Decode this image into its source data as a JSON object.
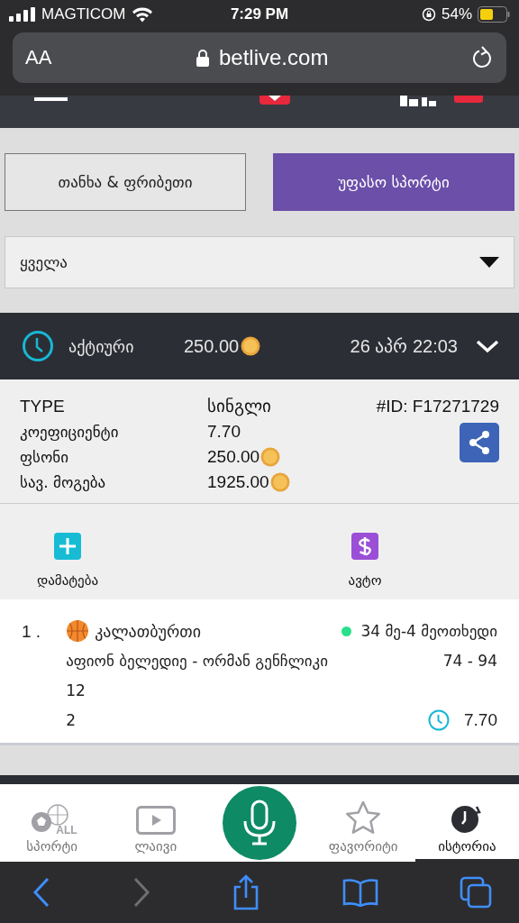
{
  "status_bar": {
    "carrier": "MAGTICOM",
    "time": "7:29 PM",
    "battery": "54%"
  },
  "browser": {
    "text_size": "AA",
    "url": "betlive.com"
  },
  "tabs": [
    {
      "label": "თანხა & ფრიბეთი",
      "selected": false
    },
    {
      "label": "უფასო სპორტი",
      "selected": true
    }
  ],
  "filter": {
    "value": "ყველა"
  },
  "bet": {
    "status": "აქტიური",
    "amount": "250.00",
    "date": "26 აპრ 22:03",
    "expanded": true,
    "details": [
      {
        "label": "TYPE",
        "value": "სინგლი",
        "coin": false
      },
      {
        "label": "კოეფიციენტი",
        "value": "7.70",
        "coin": false
      },
      {
        "label": "ფსონი",
        "value": "250.00",
        "coin": true
      },
      {
        "label": "სავ. მოგება",
        "value": "1925.00",
        "coin": true
      }
    ],
    "id": "#ID: F17271729",
    "actions": [
      {
        "kind": "add",
        "label": "დამატება"
      },
      {
        "kind": "auto",
        "label": "ავტო"
      }
    ],
    "selections": [
      {
        "index": "1 .",
        "sport": "კალათბურთი",
        "live": "34 მე-4 მეოთხედი",
        "match": "აფიონ ბელედიე - ორმან გენჩლიკი",
        "score": "74 - 94",
        "market": "12",
        "pick": "2",
        "odds": "7.70"
      }
    ]
  },
  "nav": [
    {
      "kind": "sports",
      "label": "სპორტი",
      "badge": "ALL",
      "selected": false
    },
    {
      "kind": "live",
      "label": "ლაივი",
      "selected": false
    },
    {
      "kind": "mic",
      "selected": false
    },
    {
      "kind": "favorites",
      "label": "ფავორიტი",
      "selected": false
    },
    {
      "kind": "history",
      "label": "ისტორია",
      "selected": true
    }
  ]
}
